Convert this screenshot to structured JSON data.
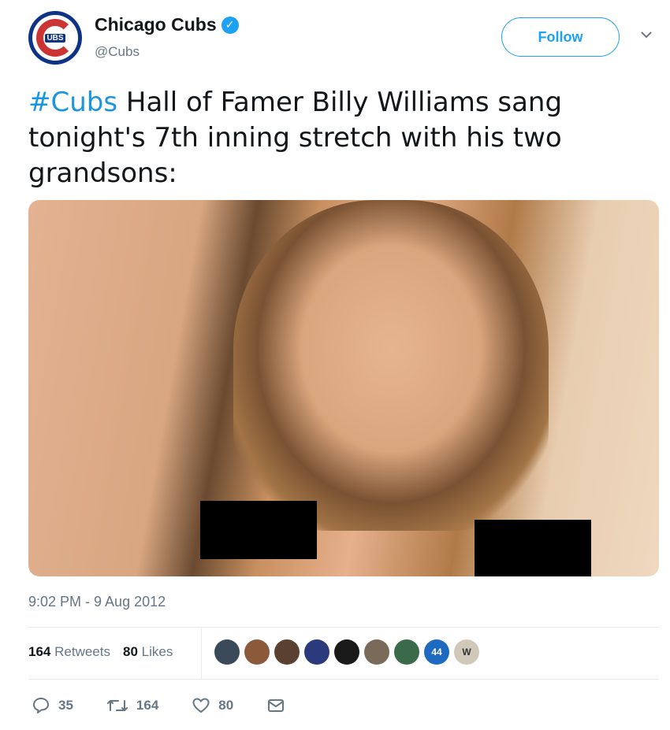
{
  "account": {
    "display_name": "Chicago Cubs",
    "handle": "@Cubs",
    "avatar_text": "UBS",
    "verified_glyph": "✓",
    "brand_blue": "#0e3386",
    "brand_red": "#cc3433"
  },
  "header": {
    "follow_label": "Follow",
    "caret_icon": "chevron-down-icon"
  },
  "tweet": {
    "hashtag": "#Cubs",
    "text": " Hall of Famer Billy Williams sang tonight's 7th inning stretch with his two grandsons:",
    "timestamp": "9:02 PM - 9 Aug 2012"
  },
  "stats": {
    "retweets_count": "164",
    "retweets_label": "Retweets",
    "likes_count": "80",
    "likes_label": "Likes"
  },
  "likers": [
    {
      "name": "liker-1",
      "color": "#3a4a5a",
      "text": ""
    },
    {
      "name": "liker-2",
      "color": "#8a5a3a",
      "text": ""
    },
    {
      "name": "liker-3",
      "color": "#5a4030",
      "text": ""
    },
    {
      "name": "liker-4",
      "color": "#2a3a7a",
      "text": ""
    },
    {
      "name": "liker-5",
      "color": "#1a1a1a",
      "text": ""
    },
    {
      "name": "liker-6",
      "color": "#7a6a5a",
      "text": ""
    },
    {
      "name": "liker-7",
      "color": "#3a6a4a",
      "text": ""
    },
    {
      "name": "liker-8",
      "color": "#1d6ac0",
      "text": "44"
    },
    {
      "name": "liker-9",
      "color": "#d0c8b8",
      "text": "W"
    }
  ],
  "actions": {
    "replies": "35",
    "retweets": "164",
    "likes": "80"
  },
  "colors": {
    "link": "#1b95e0",
    "accent": "#1da1f2",
    "muted": "#657786"
  }
}
